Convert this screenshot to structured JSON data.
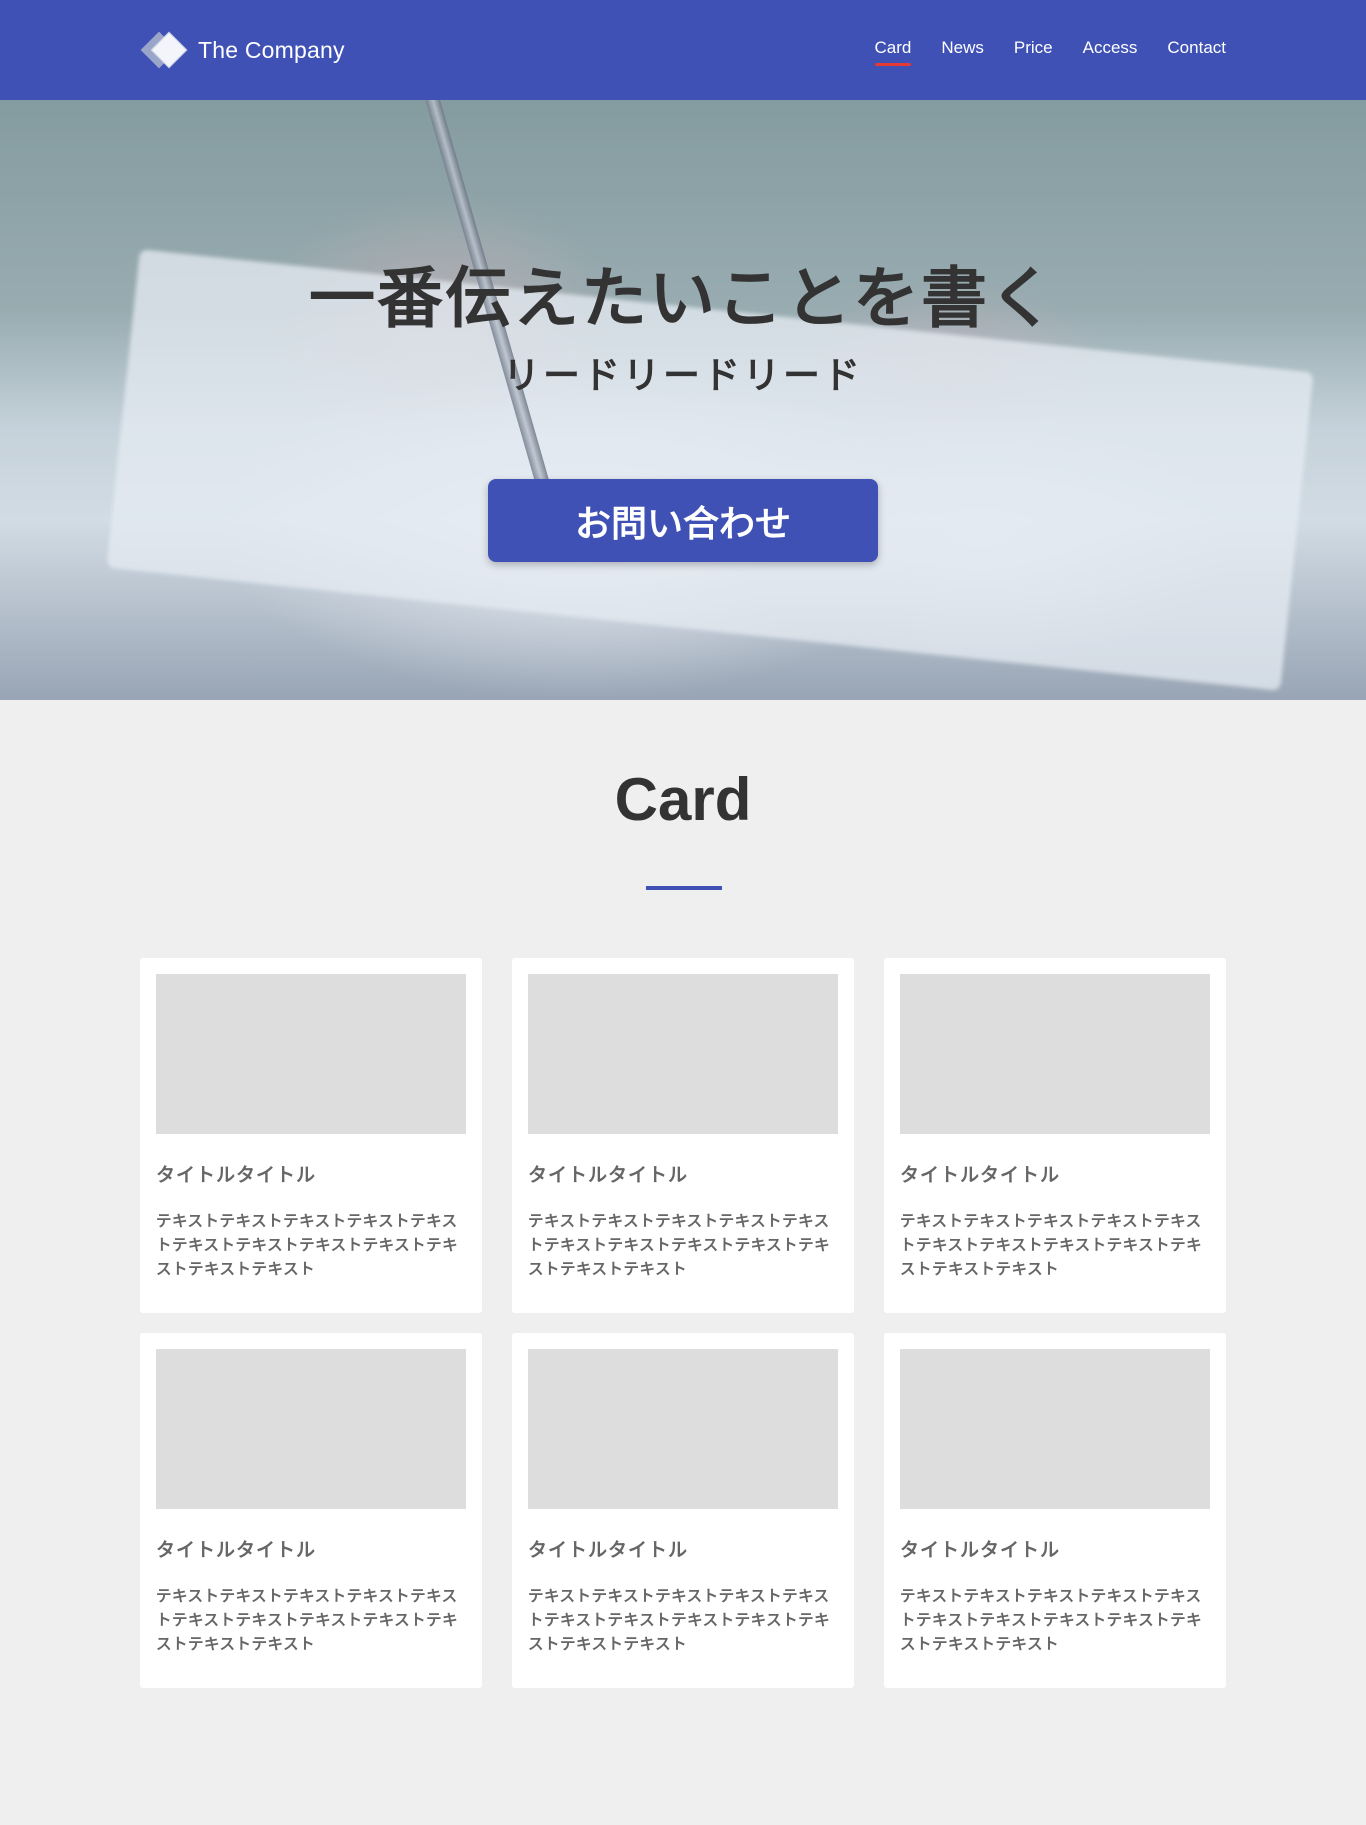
{
  "header": {
    "logo_text": "The Company",
    "nav": [
      {
        "label": "Card",
        "active": true
      },
      {
        "label": "News",
        "active": false
      },
      {
        "label": "Price",
        "active": false
      },
      {
        "label": "Access",
        "active": false
      },
      {
        "label": "Contact",
        "active": false
      }
    ]
  },
  "hero": {
    "title": "一番伝えたいことを書く",
    "lead": "リードリードリード",
    "button_label": "お問い合わせ"
  },
  "section": {
    "title": "Card"
  },
  "cards": [
    {
      "title": "タイトルタイトル",
      "text": "テキストテキストテキストテキストテキストテキストテキストテキストテキストテキストテキストテキスト"
    },
    {
      "title": "タイトルタイトル",
      "text": "テキストテキストテキストテキストテキストテキストテキストテキストテキストテキストテキストテキスト"
    },
    {
      "title": "タイトルタイトル",
      "text": "テキストテキストテキストテキストテキストテキストテキストテキストテキストテキストテキストテキスト"
    },
    {
      "title": "タイトルタイトル",
      "text": "テキストテキストテキストテキストテキストテキストテキストテキストテキストテキストテキストテキスト"
    },
    {
      "title": "タイトルタイトル",
      "text": "テキストテキストテキストテキストテキストテキストテキストテキストテキストテキストテキストテキスト"
    },
    {
      "title": "タイトルタイトル",
      "text": "テキストテキストテキストテキストテキストテキストテキストテキストテキストテキストテキストテキスト"
    }
  ],
  "colors": {
    "brand": "#3f51b5",
    "nav_active_underline": "#e53935",
    "page_background": "#efefef",
    "card_image_placeholder": "#dddddd"
  }
}
